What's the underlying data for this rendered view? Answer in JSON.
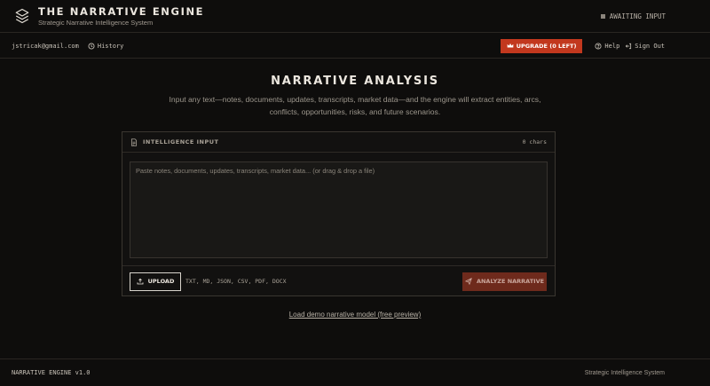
{
  "header": {
    "logo_icon": "command-center-icon",
    "title": "THE NARRATIVE ENGINE",
    "subtitle": "Strategic Narrative Intelligence System",
    "status": "AWAITING INPUT"
  },
  "subbar": {
    "email": "jstricak@gmail.com",
    "history_label": "History",
    "upgrade_label": "UPGRADE (0 LEFT)",
    "help_label": "Help",
    "signout_label": "Sign Out"
  },
  "main": {
    "title": "NARRATIVE ANALYSIS",
    "description": "Input any text—notes, documents, updates, transcripts, market data—and the engine will extract entities, arcs, conflicts, opportunities, risks, and future scenarios."
  },
  "panel": {
    "label": "INTELLIGENCE INPUT",
    "char_count": "0 chars",
    "input_value": "",
    "placeholder": "Paste notes, documents, updates, transcripts, market data... (or drag & drop a file)",
    "upload_label": "UPLOAD",
    "formats": "TXT, MD, JSON, CSV, PDF, DOCX",
    "analyze_label": "ANALYZE NARRATIVE"
  },
  "demo_link": "Load demo narrative model (free preview)",
  "footer": {
    "version": "NARRATIVE ENGINE v1.0",
    "tagline": "Strategic Intelligence System"
  },
  "colors": {
    "background": "#0e0d0c",
    "accent": "#c2381e",
    "accent_disabled": "#6e2a1c",
    "text_primary": "#ece7df",
    "text_muted": "#9c968c"
  }
}
